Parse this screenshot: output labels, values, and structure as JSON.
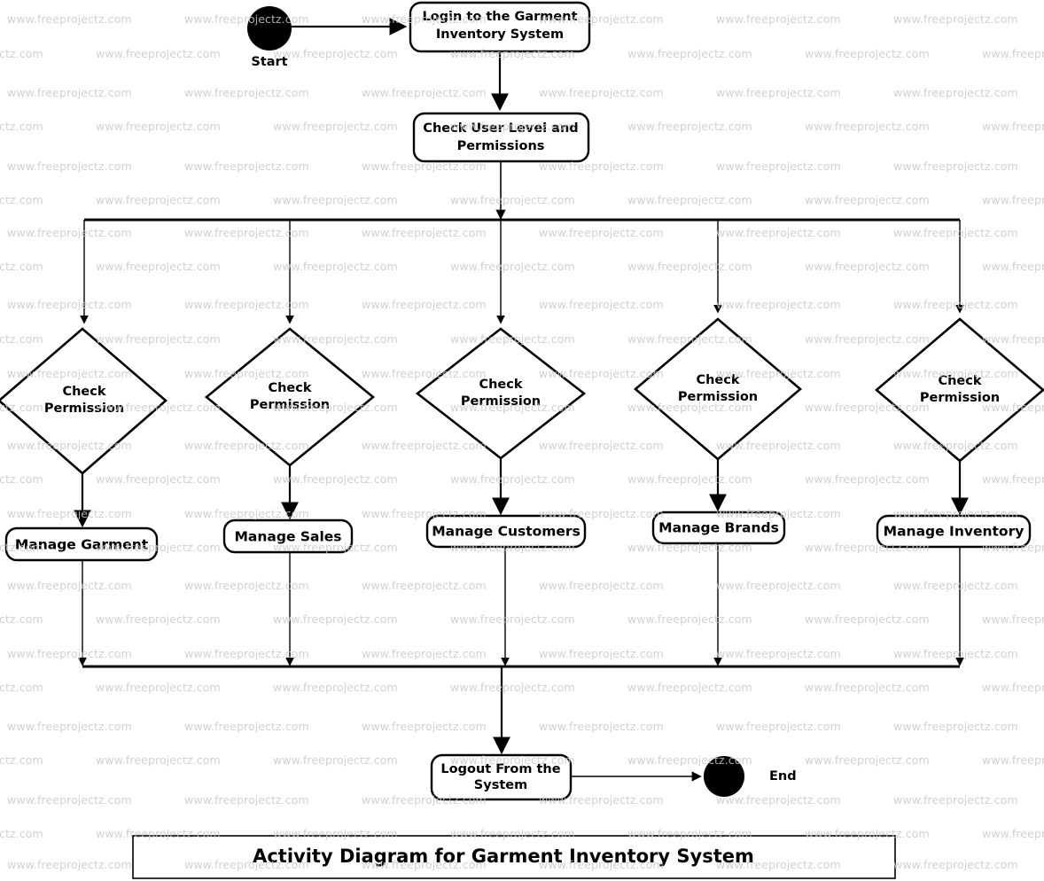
{
  "diagram": {
    "title": "Activity Diagram for Garment Inventory System",
    "watermark_text": "www.freeprojectz.com",
    "colors": {
      "stroke": "#000000",
      "fill": "#ffffff",
      "watermark": "#c9c9c9"
    },
    "start_label": "Start",
    "end_label": "End",
    "nodes": {
      "login": "Login to the Garment Inventory System",
      "login_line1": "Login to the Garment",
      "login_line2": "Inventory System",
      "check_user": "Check User Level and Permissions",
      "check_user_line1": "Check User Level and",
      "check_user_line2": "Permissions",
      "logout": "Logout From the System",
      "logout_line1": "Logout From the",
      "logout_line2": "System"
    },
    "decision_label_line1": "Check",
    "decision_label_line2": "Permission",
    "branches": [
      {
        "decision": "Check Permission",
        "activity": "Manage Garment"
      },
      {
        "decision": "Check Permission",
        "activity": "Manage Sales"
      },
      {
        "decision": "Check Permission",
        "activity": "Manage Customers"
      },
      {
        "decision": "Check Permission",
        "activity": "Manage Brands"
      },
      {
        "decision": "Check Permission",
        "activity": "Manage Inventory"
      }
    ]
  }
}
